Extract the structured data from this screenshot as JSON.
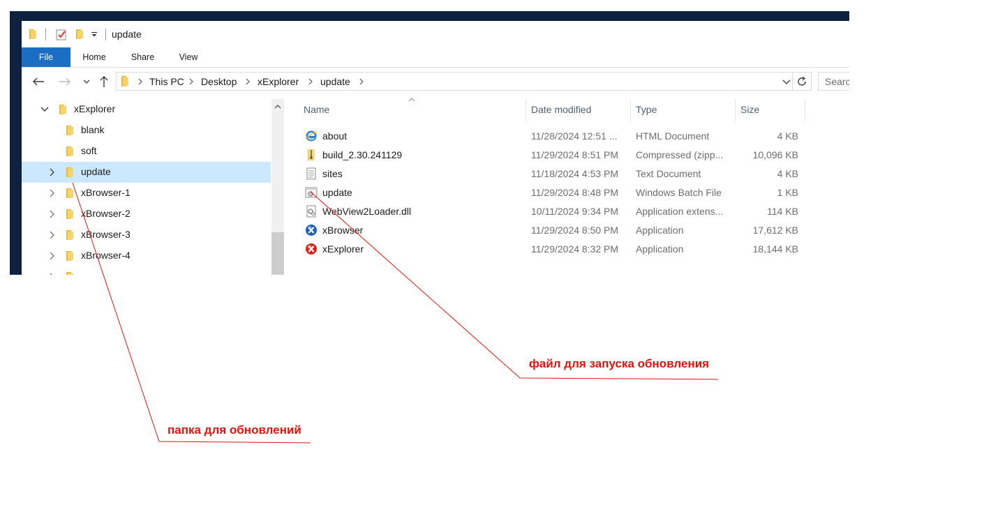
{
  "window": {
    "title": "update"
  },
  "ribbon": {
    "tabs": [
      "File",
      "Home",
      "Share",
      "View"
    ]
  },
  "nav": {
    "breadcrumbs": [
      "This PC",
      "Desktop",
      "xExplorer",
      "update"
    ],
    "search_placeholder": "Search"
  },
  "tree": {
    "items": [
      {
        "label": "xExplorer",
        "expanded": true,
        "selected": false
      },
      {
        "label": "blank",
        "selected": false
      },
      {
        "label": "soft",
        "selected": false
      },
      {
        "label": "update",
        "selected": true
      },
      {
        "label": "xBrowser-1",
        "selected": false
      },
      {
        "label": "xBrowser-2",
        "selected": false
      },
      {
        "label": "xBrowser-3",
        "selected": false
      },
      {
        "label": "xBrowser-4",
        "selected": false
      }
    ]
  },
  "columns": {
    "name": "Name",
    "date": "Date modified",
    "type": "Type",
    "size": "Size"
  },
  "files": [
    {
      "name": "about",
      "date": "11/28/2024 12:51 ...",
      "type": "HTML Document",
      "size": "4 KB",
      "icon": "html-document-icon"
    },
    {
      "name": "build_2.30.241129",
      "date": "11/29/2024 8:51 PM",
      "type": "Compressed (zipp...",
      "size": "10,096 KB",
      "icon": "zip-folder-icon"
    },
    {
      "name": "sites",
      "date": "11/18/2024 4:53 PM",
      "type": "Text Document",
      "size": "4 KB",
      "icon": "text-document-icon"
    },
    {
      "name": "update",
      "date": "11/29/2024 8:48 PM",
      "type": "Windows Batch File",
      "size": "1 KB",
      "icon": "batch-file-icon"
    },
    {
      "name": "WebView2Loader.dll",
      "date": "10/11/2024 9:34 PM",
      "type": "Application extens...",
      "size": "114 KB",
      "icon": "dll-file-icon"
    },
    {
      "name": "xBrowser",
      "date": "11/29/2024 8:50 PM",
      "type": "Application",
      "size": "17,612 KB",
      "icon": "xbrowser-app-icon"
    },
    {
      "name": "xExplorer",
      "date": "11/29/2024 8:32 PM",
      "type": "Application",
      "size": "18,144 KB",
      "icon": "xexplorer-app-icon"
    }
  ],
  "annotations": {
    "file_note": "файл для запуска обновления",
    "folder_note": "папка для обновлений"
  },
  "colors": {
    "annotation": "#e3120b",
    "accent": "#1a6fc4",
    "selection": "#cce8ff"
  }
}
